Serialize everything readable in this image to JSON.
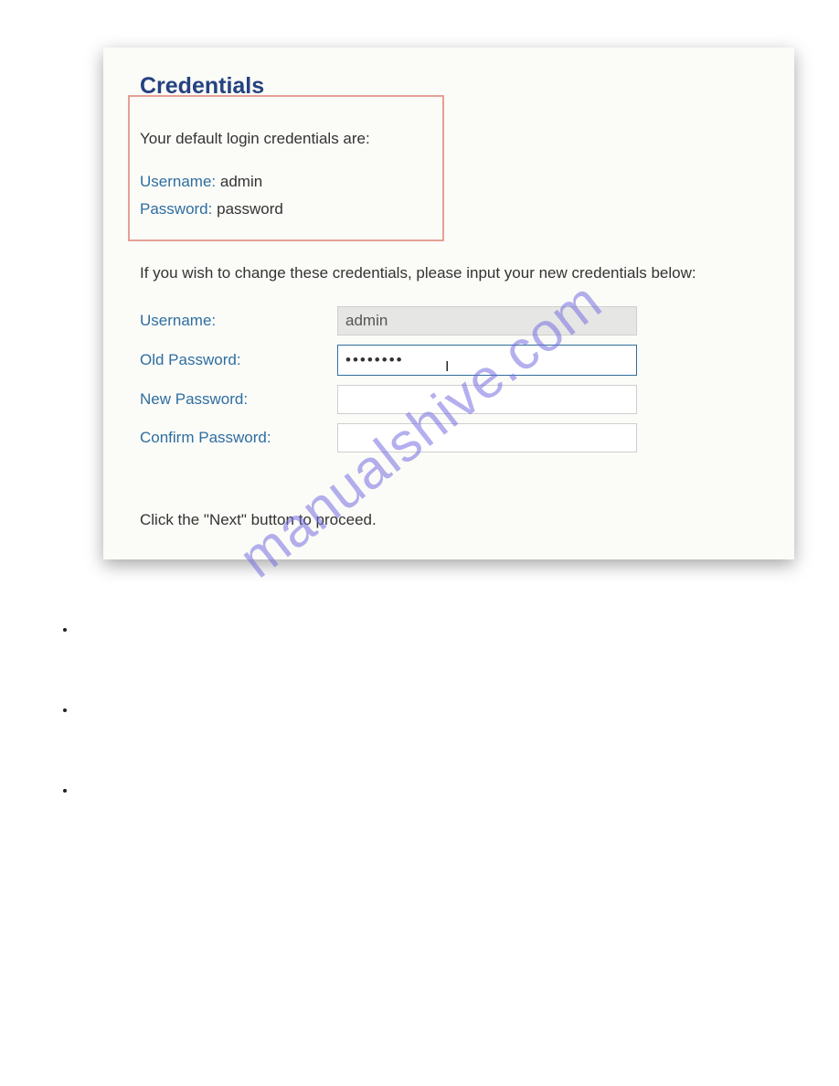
{
  "panel": {
    "title": "Credentials",
    "defaults_intro": "Your default login credentials are:",
    "username_label": "Username:",
    "username_value": "admin",
    "password_label": "Password:",
    "password_value": "password",
    "change_instruction": "If you wish to change these credentials, please input your new credentials below:",
    "form": {
      "username_label": "Username:",
      "username_value": "admin",
      "old_password_label": "Old Password:",
      "old_password_value": "••••••••",
      "new_password_label": "New Password:",
      "new_password_value": "",
      "confirm_password_label": "Confirm Password:",
      "confirm_password_value": ""
    },
    "footer": "Click the \"Next\" button to proceed."
  },
  "watermark": "manualshive.com",
  "colors": {
    "heading": "#24427f",
    "label": "#2e6ea0",
    "highlight_border": "#e4a095",
    "panel_bg": "#fbfbf8"
  }
}
